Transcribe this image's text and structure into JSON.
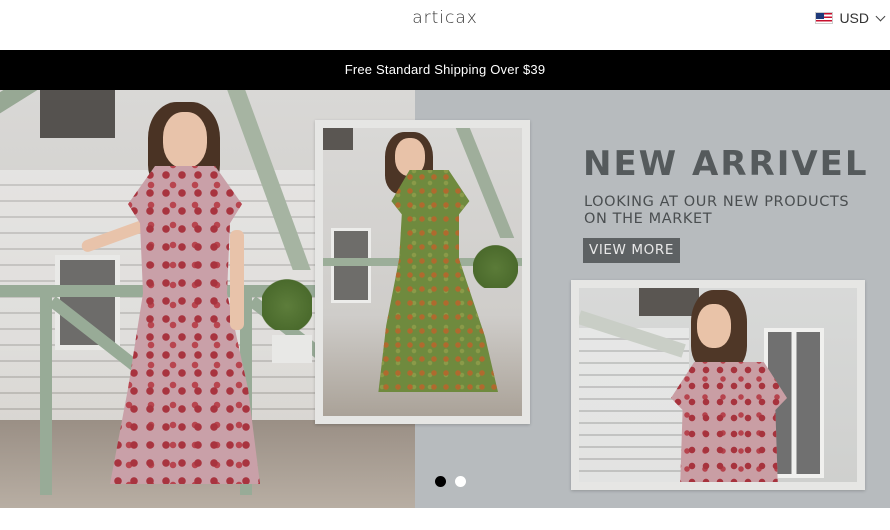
{
  "header": {
    "brand": "articax",
    "currency": {
      "label": "USD",
      "flag_icon": "us-flag-icon",
      "dropdown_icon": "chevron-down-icon"
    }
  },
  "announcement": {
    "text": "Free Standard Shipping Over $39",
    "background": "#000000",
    "color": "#ffffff"
  },
  "hero": {
    "title": "NEW ARRIVEL",
    "subtitle_line1": "LOOKING AT OUR NEW PRODUCTS",
    "subtitle_line2": "ON THE MARKET",
    "cta_label": "VIEW MORE",
    "slides_total": 2,
    "active_slide": 1,
    "colors": {
      "title": "#555a5c",
      "cta_background": "#5d6163"
    }
  }
}
